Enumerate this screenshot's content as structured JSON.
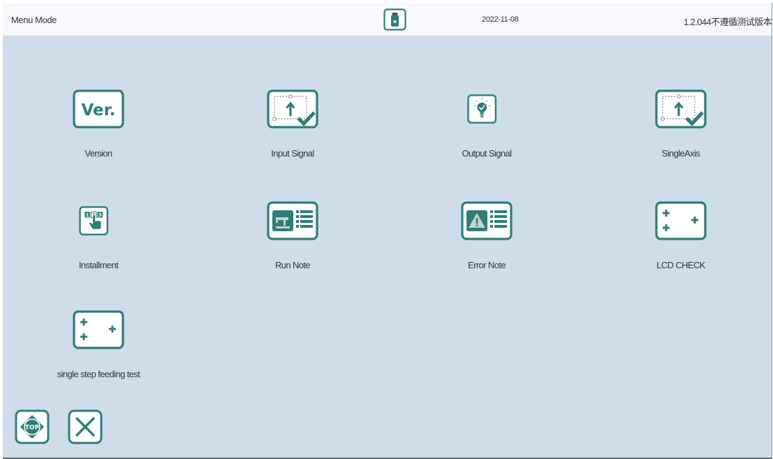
{
  "header": {
    "title": "Menu Mode",
    "date": "2022-11-08",
    "version": "1.2.044不遵循测试版本"
  },
  "menu": [
    {
      "label": "Version",
      "icon": "ver-icon"
    },
    {
      "label": "Input Signal",
      "icon": "input-signal-icon"
    },
    {
      "label": "Output Signal",
      "icon": "output-signal-icon"
    },
    {
      "label": "SingleAxis",
      "icon": "single-axis-icon"
    },
    {
      "label": "Installment",
      "icon": "installment-icon"
    },
    {
      "label": "Run Note",
      "icon": "run-note-icon"
    },
    {
      "label": "Error Note",
      "icon": "error-note-icon"
    },
    {
      "label": "LCD CHECK",
      "icon": "lcd-check-icon"
    },
    {
      "label": "single step feeding test",
      "icon": "feeding-test-icon"
    }
  ],
  "footer": {
    "top_label": "TOP",
    "ver_text": "Ver.",
    "keypad_digits": [
      "1",
      "2",
      "3"
    ]
  },
  "colors": {
    "accent": "#2e7d78",
    "background": "#cfddea",
    "header": "#f6f8fb"
  }
}
